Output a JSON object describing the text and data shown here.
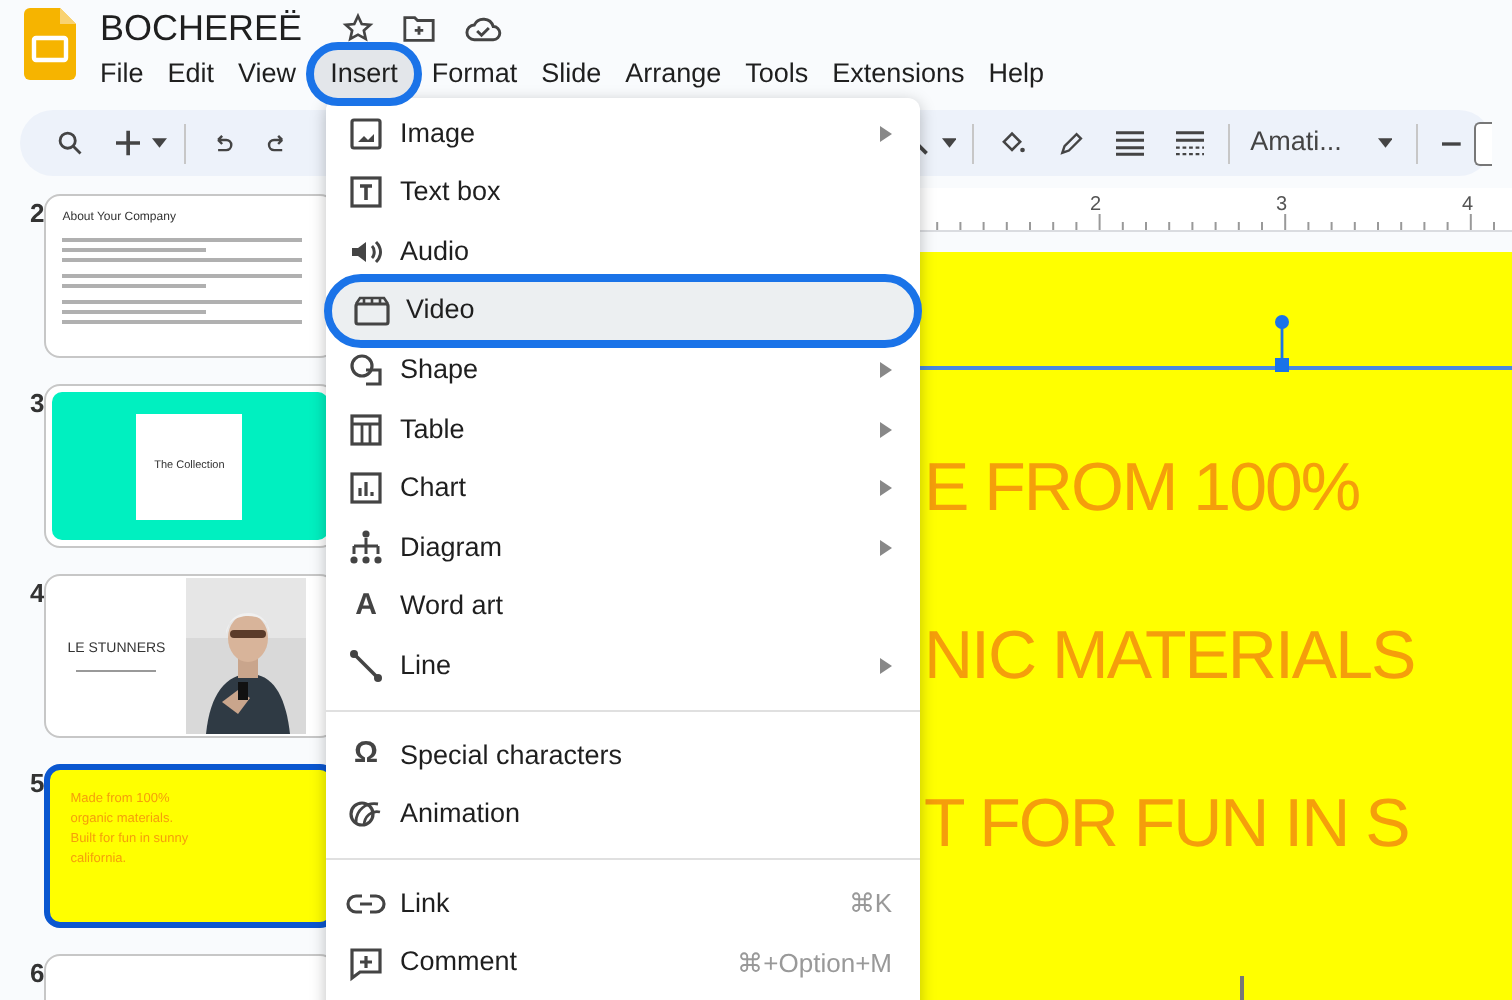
{
  "app": {
    "title": "BOCHEREË"
  },
  "menubar": [
    {
      "label": "File",
      "selected": false
    },
    {
      "label": "Edit",
      "selected": false
    },
    {
      "label": "View",
      "selected": false
    },
    {
      "label": "Insert",
      "selected": true
    },
    {
      "label": "Format",
      "selected": false
    },
    {
      "label": "Slide",
      "selected": false
    },
    {
      "label": "Arrange",
      "selected": false
    },
    {
      "label": "Tools",
      "selected": false
    },
    {
      "label": "Extensions",
      "selected": false
    },
    {
      "label": "Help",
      "selected": false
    }
  ],
  "toolbar": {
    "font": "Amati..."
  },
  "ruler": {
    "marks": [
      "2",
      "3",
      "4"
    ]
  },
  "slides": [
    {
      "number": "2",
      "kind": "text",
      "selected": false,
      "title": "About Your Company"
    },
    {
      "number": "3",
      "kind": "title_card",
      "selected": false,
      "title": "The Collection"
    },
    {
      "number": "4",
      "selected": false,
      "title": "LE STUNNERS"
    },
    {
      "number": "5",
      "kind": "lines",
      "selected": true,
      "lines": [
        "Made from 100%",
        "organic materials.",
        "Built for fun in sunny",
        "california."
      ]
    },
    {
      "number": "6",
      "kind": "partial",
      "selected": false
    }
  ],
  "canvas": {
    "lines": [
      "E FROM 100%",
      "NIC MATERIALS",
      "T FOR FUN IN S"
    ]
  },
  "insert_menu": {
    "groups": [
      [
        {
          "label": "Image",
          "submenu": true,
          "selected": false
        },
        {
          "label": "Text box",
          "submenu": false,
          "selected": false
        },
        {
          "label": "Audio",
          "submenu": false,
          "selected": false
        },
        {
          "label": "Video",
          "submenu": false,
          "selected": true
        },
        {
          "label": "Shape",
          "submenu": true,
          "selected": false
        },
        {
          "label": "Table",
          "submenu": true,
          "selected": false
        },
        {
          "label": "Chart",
          "submenu": true,
          "selected": false
        },
        {
          "label": "Diagram",
          "submenu": true,
          "selected": false
        },
        {
          "label": "Word art",
          "submenu": false,
          "selected": false,
          "icon": "A"
        },
        {
          "label": "Line",
          "submenu": true,
          "selected": false
        }
      ],
      [
        {
          "label": "Special characters",
          "submenu": false,
          "selected": false,
          "icon": "Ω"
        },
        {
          "label": "Animation",
          "submenu": false,
          "selected": false
        }
      ],
      [
        {
          "label": "Link",
          "submenu": false,
          "selected": false,
          "shortcut": "⌘K"
        },
        {
          "label": "Comment",
          "submenu": false,
          "selected": false,
          "shortcut": "⌘+Option+M"
        }
      ]
    ]
  }
}
